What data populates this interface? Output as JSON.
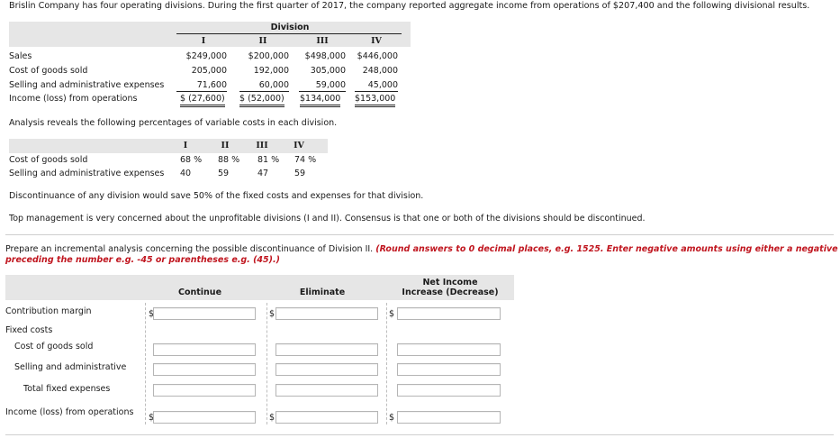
{
  "intro": "Brislin Company has four operating divisions. During the first quarter of 2017, the company reported aggregate income from operations of $207,400 and the following divisional results.",
  "division_table": {
    "header": "Division",
    "columns": [
      "I",
      "II",
      "III",
      "IV"
    ],
    "rows": [
      {
        "label": "Sales",
        "values": [
          "$249,000",
          "$200,000",
          "$498,000",
          "$446,000"
        ]
      },
      {
        "label": "Cost of goods sold",
        "values": [
          "205,000",
          "192,000",
          "305,000",
          "248,000"
        ]
      },
      {
        "label": "Selling and administrative expenses",
        "values": [
          "71,600",
          "60,000",
          "59,000",
          "45,000"
        ]
      },
      {
        "label": "Income (loss) from operations",
        "values": [
          "$ (27,600)",
          "$ (52,000)",
          "$134,000",
          "$153,000"
        ]
      }
    ]
  },
  "analysis_text": "Analysis reveals the following percentages of variable costs in each division.",
  "variable_table": {
    "columns": [
      "I",
      "II",
      "III",
      "IV"
    ],
    "rows": [
      {
        "label": "Cost of goods sold",
        "values": [
          "68 %",
          "88 %",
          "81 %",
          "74 %"
        ]
      },
      {
        "label": "Selling and administrative expenses",
        "values": [
          "40",
          "59",
          "47",
          "59"
        ]
      }
    ]
  },
  "discontinuance_text": "Discontinuance of any division would save 50% of the fixed costs and expenses for that division.",
  "management_text": "Top management is very concerned about the unprofitable divisions (I and II). Consensus is that one or both of the divisions should be discontinued.",
  "instruction": {
    "line1": "Prepare an incremental analysis concerning the possible discontinuance of Division II.",
    "red_line1": "(Round answers to 0 decimal places, e.g. 1525. Enter negative amounts using either a negative sign",
    "red_line2": "preceding the number e.g. -45 or parentheses e.g. (45).)"
  },
  "answer_table": {
    "col_continue": "Continue",
    "col_eliminate": "Eliminate",
    "col_net1": "Net Income",
    "col_net2": "Increase (Decrease)",
    "currency": "$",
    "rows": {
      "contribution_margin": "Contribution margin",
      "fixed_costs": "Fixed costs",
      "cogs": "Cost of goods sold",
      "selling_admin": "Selling and administrative",
      "total_fixed": "Total fixed expenses",
      "income_loss": "Income (loss) from operations"
    },
    "input_values": {
      "cm_continue": "",
      "cm_eliminate": "",
      "cm_net": "",
      "cogs_continue": "",
      "cogs_eliminate": "",
      "cogs_net": "",
      "sa_continue": "",
      "sa_eliminate": "",
      "sa_net": "",
      "tf_continue": "",
      "tf_eliminate": "",
      "tf_net": "",
      "il_continue": "",
      "il_eliminate": "",
      "il_net": ""
    }
  }
}
